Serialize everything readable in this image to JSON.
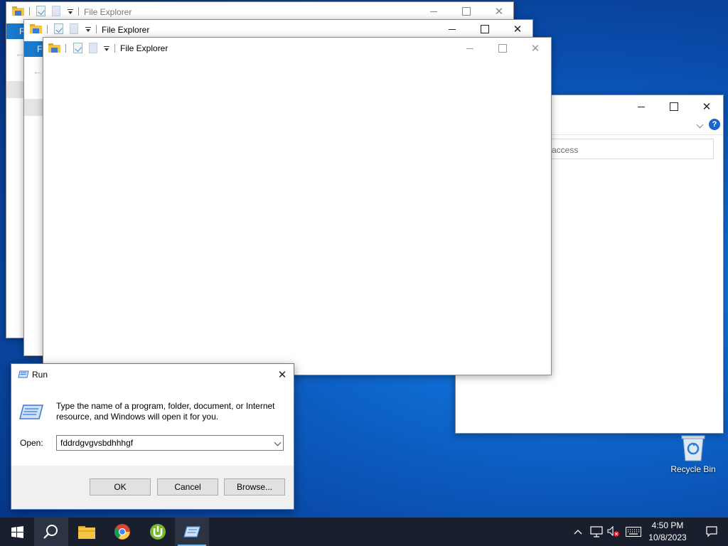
{
  "colors": {
    "accent": "#1979ca",
    "taskbar": "#1a1f2e",
    "desktop": "#0a4fb0",
    "help_badge": "#1e64c8",
    "notify_badge": "#e81123"
  },
  "explorer_windows": [
    {
      "title": "File Explorer",
      "strip_letter": "F"
    },
    {
      "title": "File Explorer",
      "strip_letter": "F"
    },
    {
      "title": "File Explorer"
    }
  ],
  "back_window": {
    "address_fragment": "access",
    "help_label": "?"
  },
  "run_dialog": {
    "title": "Run",
    "description": "Type the name of a program, folder, document, or Internet resource, and Windows will open it for you.",
    "open_label": "Open:",
    "open_value": "fddrdgvgvsbdhhhgf",
    "ok_label": "OK",
    "cancel_label": "Cancel",
    "browse_label": "Browse..."
  },
  "desktop": {
    "recycle_bin_label": "Recycle Bin"
  },
  "taskbar": {
    "pinned": [
      {
        "name": "start",
        "icon": "windows-logo-icon"
      },
      {
        "name": "search",
        "icon": "search-icon"
      },
      {
        "name": "file-explorer",
        "icon": "folder-icon"
      },
      {
        "name": "chrome",
        "icon": "chrome-icon"
      },
      {
        "name": "utorrent",
        "icon": "utorrent-icon"
      },
      {
        "name": "run",
        "icon": "run-icon"
      }
    ],
    "clock_time": "4:50 PM",
    "clock_date": "10/8/2023"
  }
}
